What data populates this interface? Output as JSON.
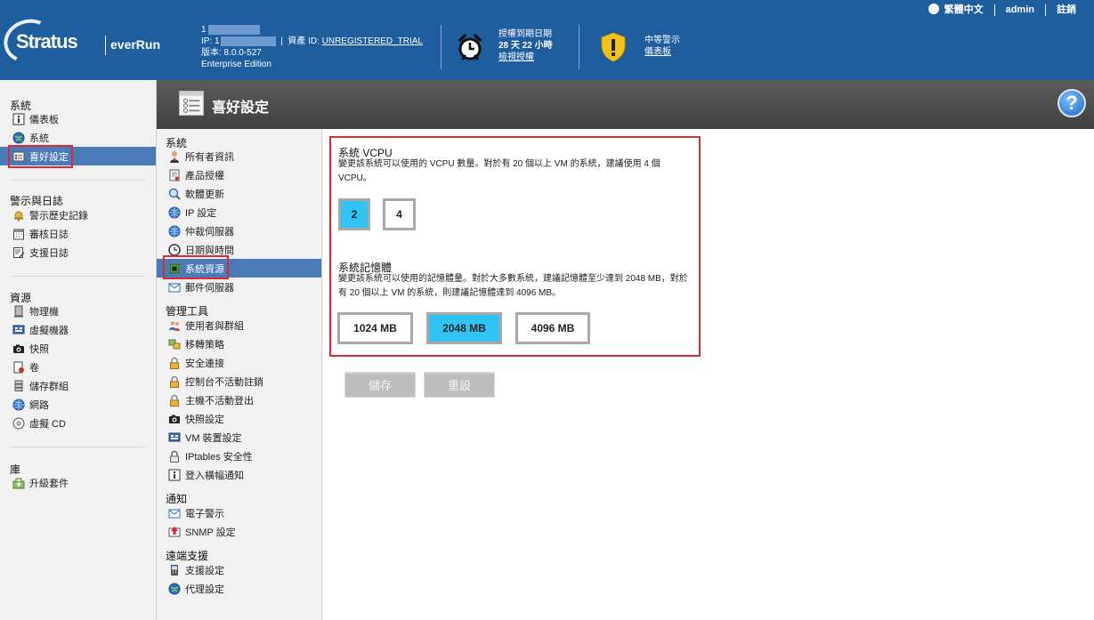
{
  "header": {
    "logo_brand": "Stratus",
    "logo_product": "everRun",
    "system_name": "1",
    "ip_label": "IP: 1",
    "asset_label": "資產 ID:",
    "asset_value": "UNREGISTERED_TRIAL",
    "version": "版本: 8.0.0-527",
    "edition": "Enterprise Edition",
    "license_title": "授權到期日期",
    "license_remaining": "28 天 22 小時",
    "license_link": "檢視授權",
    "alert_title": "中等警示",
    "alert_link": "儀表板",
    "language": "繁體中文",
    "user": "admin",
    "logout": "註銷"
  },
  "sidebar": {
    "sections": [
      {
        "title": "系統",
        "items": [
          "儀表板",
          "系統",
          "喜好設定"
        ]
      },
      {
        "title": "警示與日誌",
        "items": [
          "警示歷史記錄",
          "審核日誌",
          "支援日誌"
        ]
      },
      {
        "title": "資源",
        "items": [
          "物理機",
          "虛擬機器",
          "快照",
          "卷",
          "儲存群組",
          "網路",
          "虛擬 CD"
        ]
      },
      {
        "title": "庫",
        "items": [
          "升級套件"
        ]
      }
    ],
    "active": "喜好設定"
  },
  "page": {
    "title": "喜好設定",
    "help": "?"
  },
  "subnav": {
    "sections": [
      {
        "title": "系統",
        "items": [
          "所有者資訊",
          "產品授權",
          "軟體更新",
          "IP 設定",
          "仲裁伺服器",
          "日期與時間",
          "系統資源",
          "郵件伺服器"
        ]
      },
      {
        "title": "管理工具",
        "items": [
          "使用者與群組",
          "移轉策略",
          "安全連接",
          "控制台不活動註銷",
          "主機不活動登出",
          "快照設定",
          "VM 裝置設定",
          "IPtables 安全性",
          "登入橫幅通知"
        ]
      },
      {
        "title": "通知",
        "items": [
          "電子警示",
          "SNMP 設定"
        ]
      },
      {
        "title": "遠端支援",
        "items": [
          "支援設定",
          "代理設定"
        ]
      }
    ],
    "active": "系統資源"
  },
  "content": {
    "vcpu_title": "系統 VCPU",
    "vcpu_desc": "變更該系統可以使用的 VCPU 數量。對於有 20 個以上 VM 的系統，建議使用 4 個 VCPU。",
    "vcpu_options": [
      "2",
      "4"
    ],
    "vcpu_selected": "2",
    "mem_title": "系統記憶體",
    "mem_desc": "變更該系統可以使用的記憶體量。對於大多數系統，建議記憶體至少達到 2048 MB，對於有 20 個以上 VM 的系統，則建議記憶體達到 4096 MB。",
    "mem_options": [
      "1024 MB",
      "2048 MB",
      "4096 MB"
    ],
    "mem_selected": "2048 MB",
    "save_label": "儲存",
    "reset_label": "重設"
  },
  "colors": {
    "header_blue": "#1e5d9e",
    "selected_option": "#2fc4f3",
    "active_nav": "#4a7ab8",
    "highlight_red": "#d92b35"
  }
}
